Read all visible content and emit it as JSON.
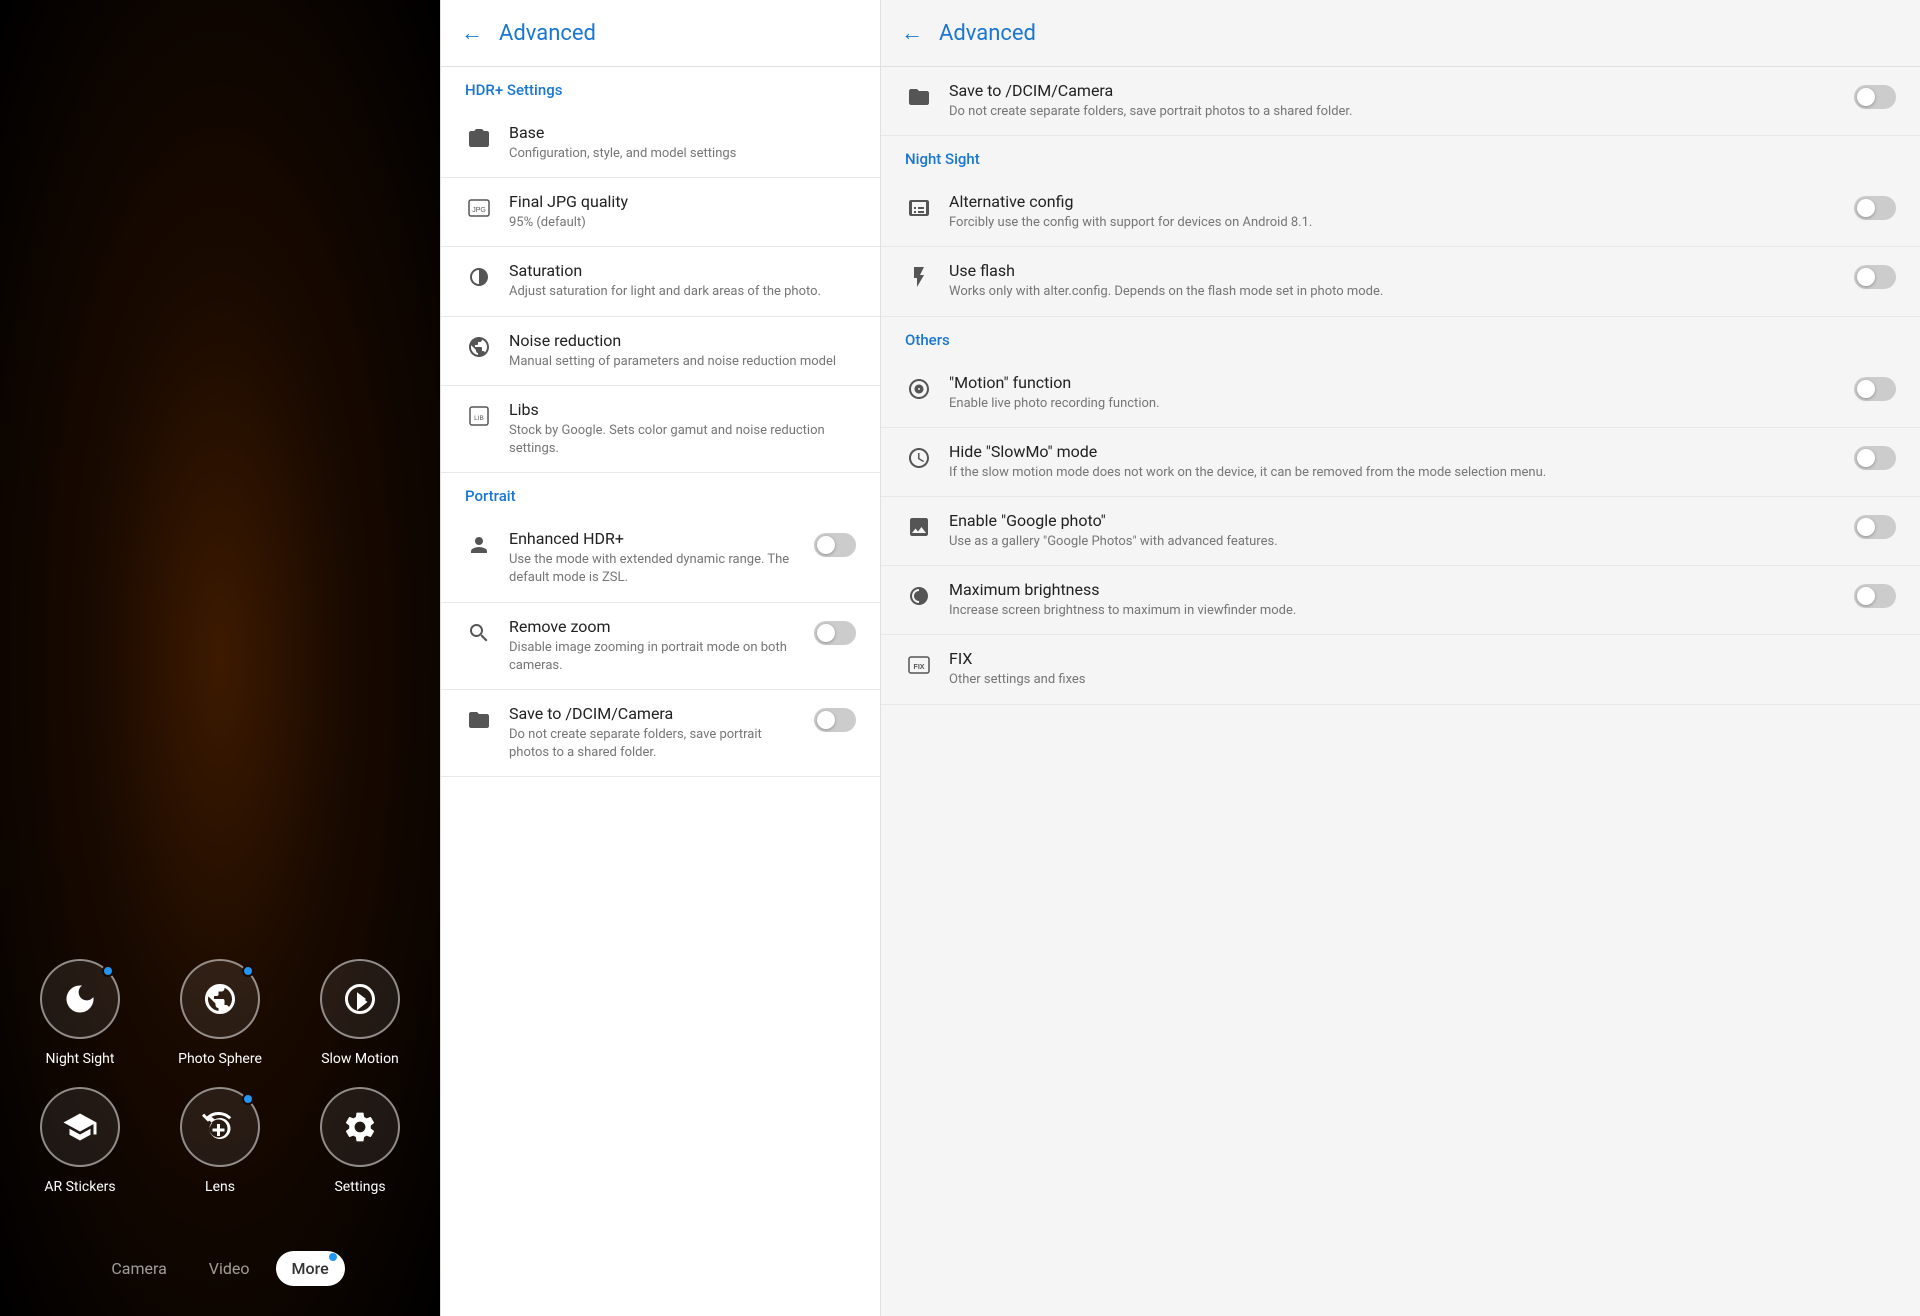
{
  "left": {
    "modes": [
      {
        "id": "night-sight",
        "label": "Night Sight",
        "badge": true,
        "icon": "moon"
      },
      {
        "id": "photo-sphere",
        "label": "Photo Sphere",
        "badge": true,
        "icon": "sphere"
      },
      {
        "id": "slow-motion",
        "label": "Slow Motion",
        "badge": false,
        "icon": "slow"
      },
      {
        "id": "ar-stickers",
        "label": "AR Stickers",
        "badge": false,
        "icon": "ar"
      },
      {
        "id": "lens",
        "label": "Lens",
        "badge": true,
        "icon": "lens"
      },
      {
        "id": "settings",
        "label": "Settings",
        "badge": false,
        "icon": "settings"
      }
    ],
    "tabs": [
      {
        "id": "camera",
        "label": "Camera",
        "active": false
      },
      {
        "id": "video",
        "label": "Video",
        "active": false
      },
      {
        "id": "more",
        "label": "More",
        "active": true
      }
    ]
  },
  "middle": {
    "header": {
      "back": "←",
      "title": "Advanced"
    },
    "sections": [
      {
        "id": "hdr-settings",
        "header": "HDR+ Settings",
        "items": [
          {
            "id": "base",
            "name": "Base",
            "desc": "Configuration, style, and model settings",
            "icon": "camera",
            "toggle": null
          },
          {
            "id": "final-jpg",
            "name": "Final JPG quality",
            "desc": "95% (default)",
            "icon": "jpg",
            "toggle": null
          },
          {
            "id": "saturation",
            "name": "Saturation",
            "desc": "Adjust saturation for light and dark areas of the photo.",
            "icon": "saturation",
            "toggle": null
          },
          {
            "id": "noise-reduction",
            "name": "Noise reduction",
            "desc": "Manual setting of parameters and noise reduction model",
            "icon": "globe",
            "toggle": null
          },
          {
            "id": "libs",
            "name": "Libs",
            "desc": "Stock by Google. Sets color gamut and noise reduction settings.",
            "icon": "libs",
            "toggle": null
          }
        ]
      },
      {
        "id": "portrait",
        "header": "Portrait",
        "items": [
          {
            "id": "enhanced-hdr",
            "name": "Enhanced HDR+",
            "desc": "Use the mode with extended dynamic range. The default mode is ZSL.",
            "icon": "person",
            "toggle": "off"
          },
          {
            "id": "remove-zoom",
            "name": "Remove zoom",
            "desc": "Disable image zooming in portrait mode on both cameras.",
            "icon": "zoom",
            "toggle": "off"
          },
          {
            "id": "save-dcim-mid",
            "name": "Save to /DCIM/Camera",
            "desc": "Do not create separate folders, save portrait photos to a shared folder.",
            "icon": "folder",
            "toggle": "off"
          }
        ]
      }
    ]
  },
  "right": {
    "header": {
      "back": "←",
      "title": "Advanced"
    },
    "sections": [
      {
        "id": "save-section",
        "header": null,
        "items": [
          {
            "id": "save-dcim-right",
            "name": "Save to /DCIM/Camera",
            "desc": "Do not create separate folders, save portrait photos to a shared folder.",
            "icon": "folder",
            "toggle": "off"
          }
        ]
      },
      {
        "id": "night-sight",
        "header": "Night Sight",
        "items": [
          {
            "id": "alt-config",
            "name": "Alternative config",
            "desc": "Forcibly use the config with support for devices on Android 8.1.",
            "icon": "config",
            "toggle": "off"
          },
          {
            "id": "use-flash",
            "name": "Use flash",
            "desc": "Works only with alter.config. Depends on the flash mode set in photo mode.",
            "icon": "flash",
            "toggle": "off"
          }
        ]
      },
      {
        "id": "others",
        "header": "Others",
        "items": [
          {
            "id": "motion-function",
            "name": "\"Motion\" function",
            "desc": "Enable live photo recording function.",
            "icon": "motion",
            "toggle": "off"
          },
          {
            "id": "hide-slowmo",
            "name": "Hide \"SlowMo\" mode",
            "desc": "If the slow motion mode does not work on the device, it can be removed from the mode selection menu.",
            "icon": "slowmo",
            "toggle": "off"
          },
          {
            "id": "enable-google-photo",
            "name": "Enable \"Google photo\"",
            "desc": "Use as a gallery \"Google Photos\" with advanced features.",
            "icon": "photo",
            "toggle": "off"
          },
          {
            "id": "max-brightness",
            "name": "Maximum brightness",
            "desc": "Increase screen brightness to maximum in viewfinder mode.",
            "icon": "brightness",
            "toggle": "off"
          },
          {
            "id": "fix",
            "name": "FIX",
            "desc": "Other settings and fixes",
            "icon": "fix",
            "toggle": null
          }
        ]
      }
    ]
  }
}
